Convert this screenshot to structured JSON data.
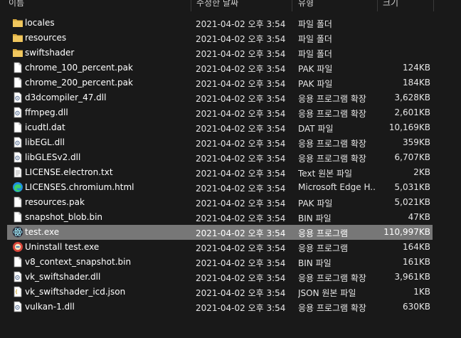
{
  "columns": {
    "name": "이름",
    "date": "수정한 날짜",
    "type": "유형",
    "size": "크기"
  },
  "files": [
    {
      "name": "locales",
      "date": "2021-04-02 오후 3:54",
      "type": "파일 폴더",
      "size": "",
      "icon": "folder-icon"
    },
    {
      "name": "resources",
      "date": "2021-04-02 오후 3:54",
      "type": "파일 폴더",
      "size": "",
      "icon": "folder-icon"
    },
    {
      "name": "swiftshader",
      "date": "2021-04-02 오후 3:54",
      "type": "파일 폴더",
      "size": "",
      "icon": "folder-icon"
    },
    {
      "name": "chrome_100_percent.pak",
      "date": "2021-04-02 오후 3:54",
      "type": "PAK 파일",
      "size": "124KB",
      "icon": "file-icon"
    },
    {
      "name": "chrome_200_percent.pak",
      "date": "2021-04-02 오후 3:54",
      "type": "PAK 파일",
      "size": "184KB",
      "icon": "file-icon"
    },
    {
      "name": "d3dcompiler_47.dll",
      "date": "2021-04-02 오후 3:54",
      "type": "응용 프로그램 확장",
      "size": "3,628KB",
      "icon": "dll-icon"
    },
    {
      "name": "ffmpeg.dll",
      "date": "2021-04-02 오후 3:54",
      "type": "응용 프로그램 확장",
      "size": "2,601KB",
      "icon": "dll-icon"
    },
    {
      "name": "icudtl.dat",
      "date": "2021-04-02 오후 3:54",
      "type": "DAT 파일",
      "size": "10,169KB",
      "icon": "file-icon"
    },
    {
      "name": "libEGL.dll",
      "date": "2021-04-02 오후 3:54",
      "type": "응용 프로그램 확장",
      "size": "359KB",
      "icon": "dll-icon"
    },
    {
      "name": "libGLESv2.dll",
      "date": "2021-04-02 오후 3:54",
      "type": "응용 프로그램 확장",
      "size": "6,707KB",
      "icon": "dll-icon"
    },
    {
      "name": "LICENSE.electron.txt",
      "date": "2021-04-02 오후 3:54",
      "type": "Text 원본 파일",
      "size": "2KB",
      "icon": "text-file-icon"
    },
    {
      "name": "LICENSES.chromium.html",
      "date": "2021-04-02 오후 3:54",
      "type": "Microsoft Edge H...",
      "size": "5,031KB",
      "icon": "edge-icon"
    },
    {
      "name": "resources.pak",
      "date": "2021-04-02 오후 3:54",
      "type": "PAK 파일",
      "size": "5,021KB",
      "icon": "file-icon"
    },
    {
      "name": "snapshot_blob.bin",
      "date": "2021-04-02 오후 3:54",
      "type": "BIN 파일",
      "size": "47KB",
      "icon": "file-icon"
    },
    {
      "name": "test.exe",
      "date": "2021-04-02 오후 3:54",
      "type": "응용 프로그램",
      "size": "110,997KB",
      "icon": "electron-app-icon",
      "selected": true
    },
    {
      "name": "Uninstall test.exe",
      "date": "2021-04-02 오후 3:54",
      "type": "응용 프로그램",
      "size": "164KB",
      "icon": "uninstaller-icon"
    },
    {
      "name": "v8_context_snapshot.bin",
      "date": "2021-04-02 오후 3:54",
      "type": "BIN 파일",
      "size": "161KB",
      "icon": "file-icon"
    },
    {
      "name": "vk_swiftshader.dll",
      "date": "2021-04-02 오후 3:54",
      "type": "응용 프로그램 확장",
      "size": "3,961KB",
      "icon": "dll-icon"
    },
    {
      "name": "vk_swiftshader_icd.json",
      "date": "2021-04-02 오후 3:54",
      "type": "JSON 원본 파일",
      "size": "1KB",
      "icon": "json-file-icon"
    },
    {
      "name": "vulkan-1.dll",
      "date": "2021-04-02 오후 3:54",
      "type": "응용 프로그램 확장",
      "size": "630KB",
      "icon": "dll-icon"
    }
  ],
  "colors": {
    "background": "#191919",
    "selection": "#777777",
    "folder": "#e8b84a",
    "text": "#ffffff"
  }
}
